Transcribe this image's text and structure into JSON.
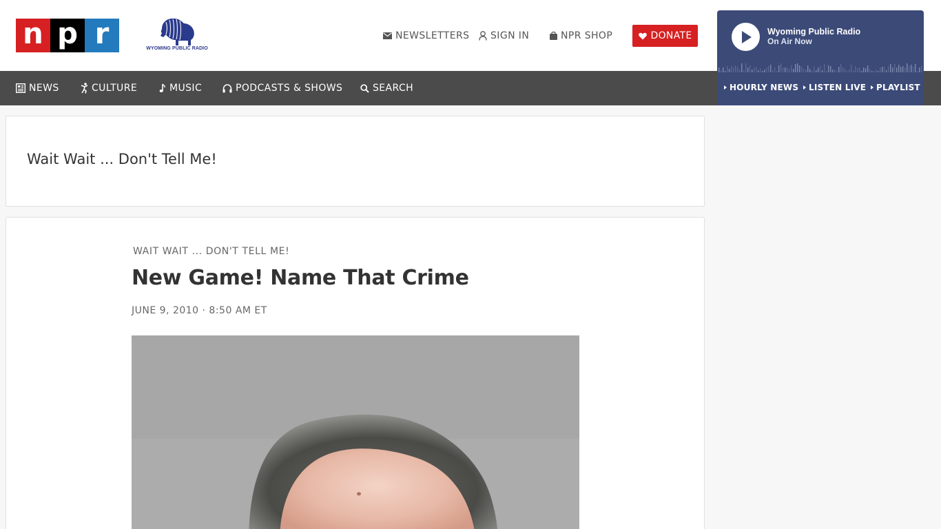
{
  "header": {
    "npr_logo": [
      "n",
      "p",
      "r"
    ],
    "station_logo_text": "WYOMING PUBLIC RADIO",
    "utility_links": {
      "newsletters": "NEWSLETTERS",
      "sign_in": "SIGN IN",
      "shop": "NPR SHOP"
    },
    "donate_label": "DONATE"
  },
  "nav": {
    "news": "NEWS",
    "culture": "CULTURE",
    "music": "MUSIC",
    "podcasts": "PODCASTS & SHOWS",
    "search": "SEARCH"
  },
  "player": {
    "station_name": "Wyoming Public Radio",
    "status": "On Air Now",
    "links": {
      "hourly_news": "HOURLY NEWS",
      "listen_live": "LISTEN LIVE",
      "playlist": "PLAYLIST"
    }
  },
  "program": {
    "title": "Wait Wait ... Don't Tell Me!"
  },
  "article": {
    "slug": "WAIT WAIT ... DON'T TELL ME!",
    "headline": "New Game! Name That Crime",
    "dateline": "JUNE 9, 2010 · 8:50 AM ET"
  },
  "colors": {
    "npr_red": "#d62021",
    "npr_black": "#000000",
    "npr_blue": "#237bbd",
    "nav_bg": "#4b4b4b",
    "player_bg": "#3c4a78",
    "donate_bg": "#d62021"
  },
  "icons": {
    "newsletters": "envelope-icon",
    "sign_in": "user-icon",
    "shop": "shopping-bag-icon",
    "donate": "heart-icon",
    "news": "newspaper-icon",
    "culture": "dancer-icon",
    "music": "music-note-icon",
    "podcasts": "headphones-icon",
    "search": "search-icon",
    "player": "play-icon"
  }
}
